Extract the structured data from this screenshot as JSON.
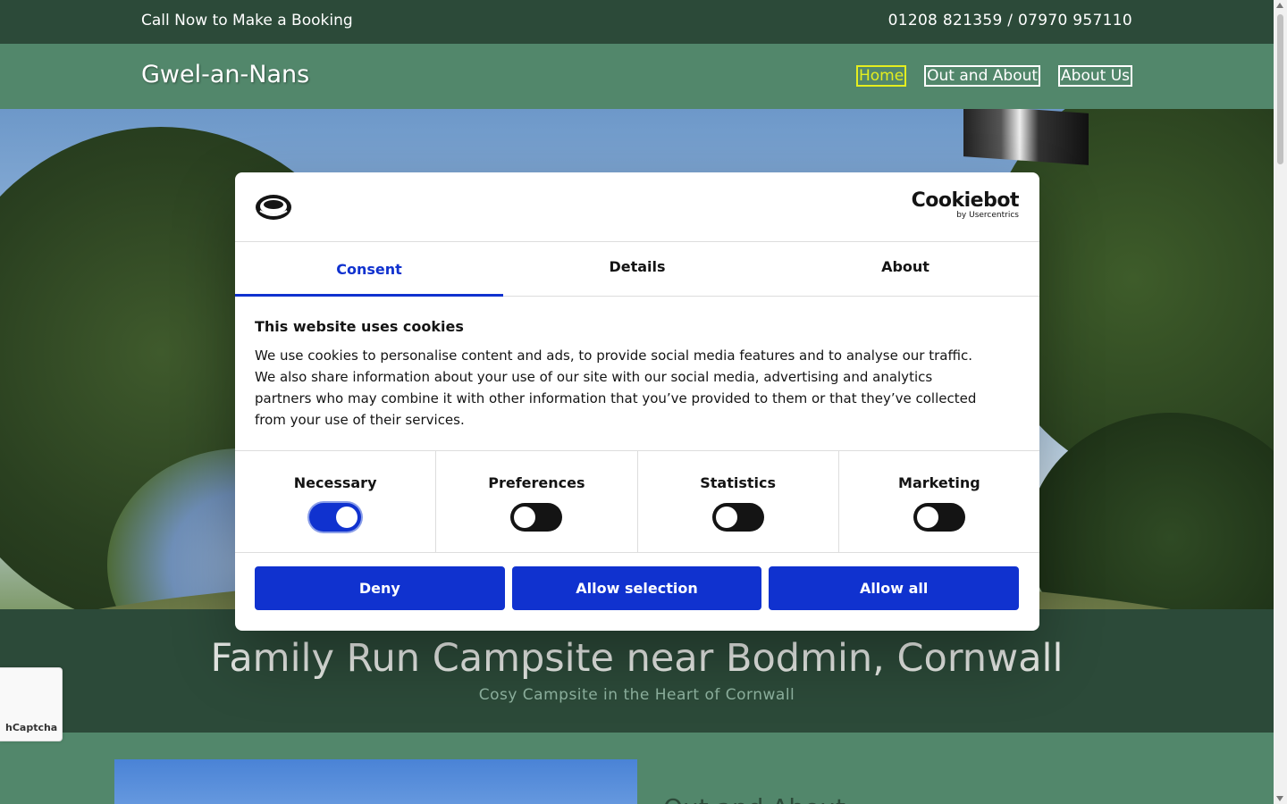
{
  "topbar": {
    "cta": "Call Now to Make a Booking",
    "phones": "01208 821359 / 07970 957110"
  },
  "nav": {
    "brand": "Gwel-an-Nans",
    "links": [
      "Home",
      "Out and About",
      "About Us"
    ],
    "active": "Home",
    "active_color": "#e4ee1f"
  },
  "hero": {
    "title": "Family Run Campsite near Bodmin, Cornwall",
    "subtitle": "Cosy Campsite in the Heart of Cornwall"
  },
  "lower": {
    "heading": "Out and About"
  },
  "captcha": {
    "label": "hCaptcha"
  },
  "cookie_dialog": {
    "brand": "Cookiebot",
    "brand_sub": "by Usercentrics",
    "tabs": [
      "Consent",
      "Details",
      "About"
    ],
    "active_tab": "Consent",
    "heading": "This website uses cookies",
    "body": "We use cookies to personalise content and ads, to provide social media features and to analyse our traffic. We also share information about your use of our site with our social media, advertising and analytics partners who may combine it with other information that you’ve provided to them or that they’ve collected from your use of their services.",
    "categories": [
      {
        "label": "Necessary",
        "enabled": true
      },
      {
        "label": "Preferences",
        "enabled": false
      },
      {
        "label": "Statistics",
        "enabled": false
      },
      {
        "label": "Marketing",
        "enabled": false
      }
    ],
    "buttons": [
      "Deny",
      "Allow selection",
      "Allow all"
    ],
    "accent_color": "#1032cf"
  },
  "colors": {
    "dark_green": "#2c4a39",
    "mid_green": "#52876b"
  }
}
